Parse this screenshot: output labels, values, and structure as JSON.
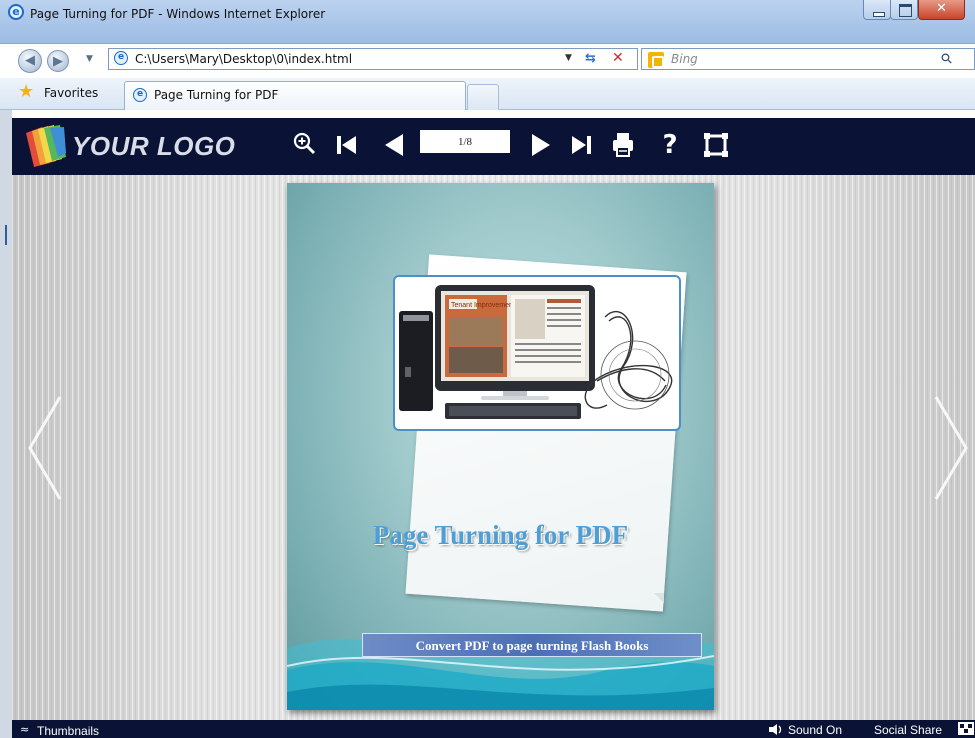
{
  "window": {
    "title": "Page Turning for PDF - Windows Internet Explorer"
  },
  "address_bar": {
    "url": "C:\\Users\\Mary\\Desktop\\0\\index.html",
    "search_placeholder": "Bing"
  },
  "favorites_bar": {
    "favorites_label": "Favorites",
    "tab_label": "Page Turning for PDF"
  },
  "flipbook": {
    "logo_text": "YOUR LOGO",
    "page_indicator": "1/8",
    "help_glyph": "?",
    "icons": [
      "zoom-in",
      "first-page",
      "previous-page",
      "next-page",
      "last-page",
      "print",
      "help",
      "fullscreen"
    ]
  },
  "cover": {
    "title": "Page Turning for PDF",
    "subtitle": "Convert PDF to  page turning Flash Books",
    "screen_heading": "Tenant Improvement"
  },
  "bottom_bar": {
    "thumbnails_label": "Thumbnails",
    "sound_label": "Sound On",
    "social_label": "Social Share"
  },
  "colors": {
    "toolbar_bg": "#0a1236",
    "cover_title": "#4f9fd6",
    "subtitle_bar": "#4b6eb7"
  }
}
